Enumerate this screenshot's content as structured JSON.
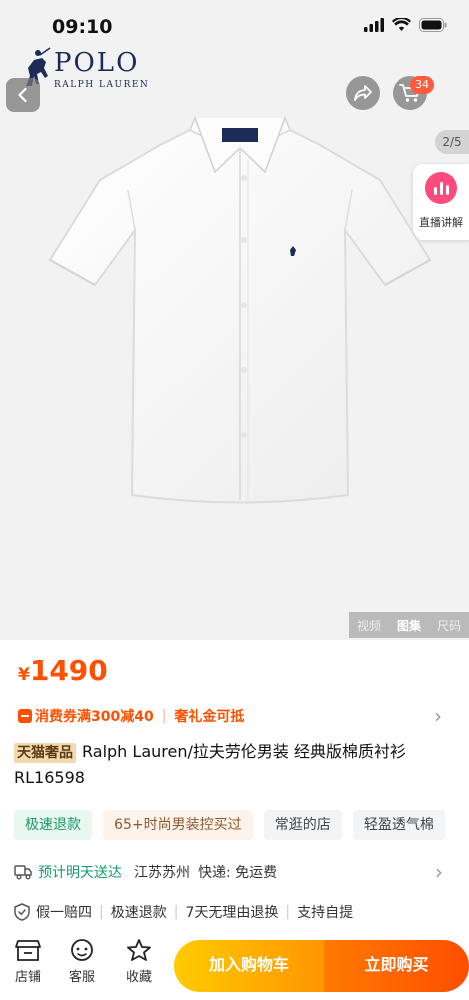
{
  "status_bar": {
    "time": "09:10"
  },
  "brand": {
    "name": "POLO",
    "sub": "RALPH LAUREN"
  },
  "header": {
    "cart_count": "34",
    "image_index": "2/5",
    "live_label": "直播讲解"
  },
  "media_tabs": [
    "视频",
    "图集",
    "尺码"
  ],
  "price": {
    "currency": "¥",
    "amount": "1490"
  },
  "coupon": {
    "offer": "消费券满300减40",
    "gift": "奢礼金可抵"
  },
  "product": {
    "tag": "天猫奢品",
    "title": "Ralph Lauren/拉夫劳伦男装 经典版棉质衬衫RL16598"
  },
  "chips": [
    "极速退款",
    "65+时尚男装控买过",
    "常逛的店",
    "轻盈透气棉"
  ],
  "shipping": {
    "eta": "预计明天送达",
    "origin": "江苏苏州",
    "express": "快递: 免运费"
  },
  "guarantees": [
    "假一赔四",
    "极速退款",
    "7天无理由退换",
    "支持自提"
  ],
  "bottom_nav": {
    "shop": "店铺",
    "service": "客服",
    "favorite": "收藏"
  },
  "actions": {
    "add_to_cart": "加入购物车",
    "buy_now": "立即购买"
  },
  "colors": {
    "accent": "#ff5000",
    "brand_navy": "#1d2b57",
    "green": "#1a9a6a"
  }
}
